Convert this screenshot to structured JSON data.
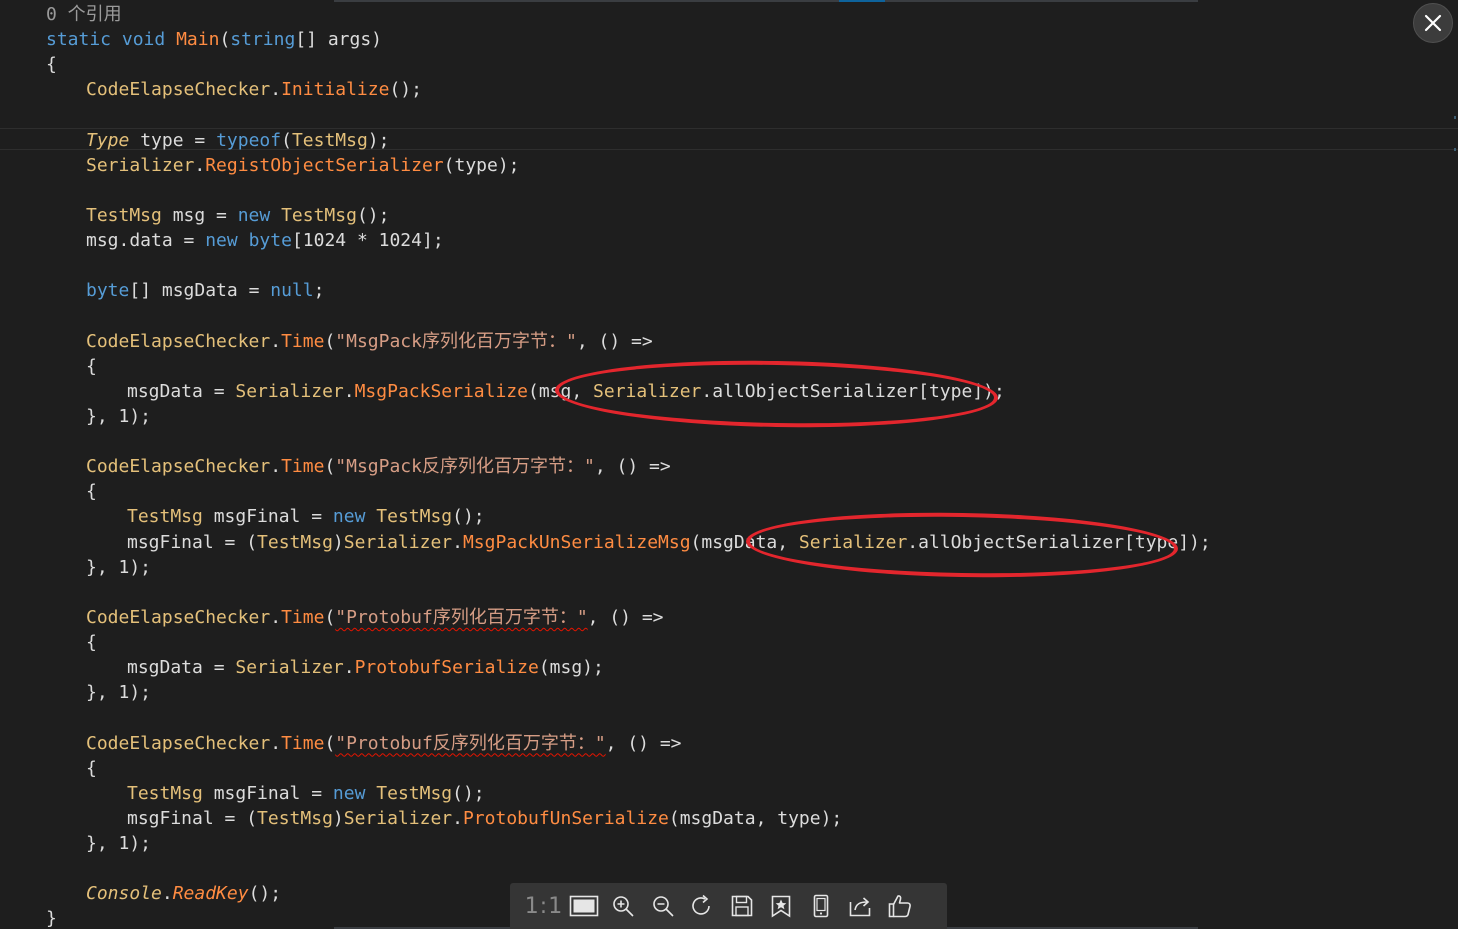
{
  "editor": {
    "lines": [
      {
        "indent": 1,
        "tokens": [
          {
            "t": "0 个引用",
            "c": "ref"
          }
        ]
      },
      {
        "indent": 1,
        "tokens": [
          {
            "t": "static",
            "c": "kw"
          },
          {
            "t": " ",
            "c": "pln"
          },
          {
            "t": "void",
            "c": "kw"
          },
          {
            "t": " ",
            "c": "pln"
          },
          {
            "t": "Main",
            "c": "mth"
          },
          {
            "t": "(",
            "c": "pln"
          },
          {
            "t": "string",
            "c": "kw"
          },
          {
            "t": "[] args)",
            "c": "pln"
          }
        ]
      },
      {
        "indent": 1,
        "tokens": [
          {
            "t": "{",
            "c": "pln"
          }
        ]
      },
      {
        "indent": 2,
        "tokens": [
          {
            "t": "CodeElapseChecker",
            "c": "cls"
          },
          {
            "t": ".",
            "c": "pln"
          },
          {
            "t": "Initialize",
            "c": "mth"
          },
          {
            "t": "();",
            "c": "pln"
          }
        ]
      },
      {
        "indent": 0,
        "tokens": []
      },
      {
        "indent": 2,
        "tokens": [
          {
            "t": "Type",
            "c": "cls ital"
          },
          {
            "t": " type = ",
            "c": "pln"
          },
          {
            "t": "typeof",
            "c": "kw"
          },
          {
            "t": "(",
            "c": "pln"
          },
          {
            "t": "TestMsg",
            "c": "cls"
          },
          {
            "t": ");",
            "c": "pln"
          }
        ]
      },
      {
        "indent": 2,
        "tokens": [
          {
            "t": "Serializer",
            "c": "cls"
          },
          {
            "t": ".",
            "c": "pln"
          },
          {
            "t": "RegistObjectSerializer",
            "c": "mth"
          },
          {
            "t": "(type);",
            "c": "pln"
          }
        ]
      },
      {
        "indent": 0,
        "tokens": []
      },
      {
        "indent": 2,
        "tokens": [
          {
            "t": "TestMsg",
            "c": "cls"
          },
          {
            "t": " msg = ",
            "c": "pln"
          },
          {
            "t": "new",
            "c": "kw"
          },
          {
            "t": " ",
            "c": "pln"
          },
          {
            "t": "TestMsg",
            "c": "cls"
          },
          {
            "t": "();",
            "c": "pln"
          }
        ]
      },
      {
        "indent": 2,
        "tokens": [
          {
            "t": "msg.data = ",
            "c": "pln"
          },
          {
            "t": "new",
            "c": "kw"
          },
          {
            "t": " ",
            "c": "pln"
          },
          {
            "t": "byte",
            "c": "kw"
          },
          {
            "t": "[1024 * 1024];",
            "c": "pln"
          }
        ]
      },
      {
        "indent": 0,
        "tokens": []
      },
      {
        "indent": 2,
        "tokens": [
          {
            "t": "byte",
            "c": "kw"
          },
          {
            "t": "[] msgData = ",
            "c": "pln"
          },
          {
            "t": "null",
            "c": "kw"
          },
          {
            "t": ";",
            "c": "pln"
          }
        ]
      },
      {
        "indent": 0,
        "tokens": []
      },
      {
        "indent": 2,
        "tokens": [
          {
            "t": "CodeElapseChecker",
            "c": "cls"
          },
          {
            "t": ".",
            "c": "pln"
          },
          {
            "t": "Time",
            "c": "mth"
          },
          {
            "t": "(",
            "c": "pln"
          },
          {
            "t": "\"MsgPack序列化百万字节：\"",
            "c": "str"
          },
          {
            "t": ", () =>",
            "c": "pln"
          }
        ]
      },
      {
        "indent": 2,
        "tokens": [
          {
            "t": "{",
            "c": "pln"
          }
        ]
      },
      {
        "indent": 3,
        "tokens": [
          {
            "t": "msgData = ",
            "c": "pln"
          },
          {
            "t": "Serializer",
            "c": "cls"
          },
          {
            "t": ".",
            "c": "pln"
          },
          {
            "t": "MsgPackSerialize",
            "c": "mth"
          },
          {
            "t": "(msg, ",
            "c": "pln"
          },
          {
            "t": "Serializer",
            "c": "cls"
          },
          {
            "t": ".allObjectSerializer[type]);",
            "c": "pln"
          }
        ]
      },
      {
        "indent": 2,
        "tokens": [
          {
            "t": "}, 1);",
            "c": "pln"
          }
        ]
      },
      {
        "indent": 0,
        "tokens": []
      },
      {
        "indent": 2,
        "tokens": [
          {
            "t": "CodeElapseChecker",
            "c": "cls"
          },
          {
            "t": ".",
            "c": "pln"
          },
          {
            "t": "Time",
            "c": "mth"
          },
          {
            "t": "(",
            "c": "pln"
          },
          {
            "t": "\"MsgPack反序列化百万字节：\"",
            "c": "str"
          },
          {
            "t": ", () =>",
            "c": "pln"
          }
        ]
      },
      {
        "indent": 2,
        "tokens": [
          {
            "t": "{",
            "c": "pln"
          }
        ]
      },
      {
        "indent": 3,
        "tokens": [
          {
            "t": "TestMsg",
            "c": "cls"
          },
          {
            "t": " msgFinal = ",
            "c": "pln"
          },
          {
            "t": "new",
            "c": "kw"
          },
          {
            "t": " ",
            "c": "pln"
          },
          {
            "t": "TestMsg",
            "c": "cls"
          },
          {
            "t": "();",
            "c": "pln"
          }
        ]
      },
      {
        "indent": 3,
        "tokens": [
          {
            "t": "msgFinal = (",
            "c": "pln"
          },
          {
            "t": "TestMsg",
            "c": "cls"
          },
          {
            "t": ")",
            "c": "pln"
          },
          {
            "t": "Serializer",
            "c": "cls"
          },
          {
            "t": ".",
            "c": "pln"
          },
          {
            "t": "MsgPackUnSerializeMsg",
            "c": "mth"
          },
          {
            "t": "(msgData, ",
            "c": "pln"
          },
          {
            "t": "Serializer",
            "c": "cls"
          },
          {
            "t": ".allObjectSerializer[type]);",
            "c": "pln"
          }
        ]
      },
      {
        "indent": 2,
        "tokens": [
          {
            "t": "}, 1);",
            "c": "pln"
          }
        ]
      },
      {
        "indent": 0,
        "tokens": []
      },
      {
        "indent": 2,
        "tokens": [
          {
            "t": "CodeElapseChecker",
            "c": "cls"
          },
          {
            "t": ".",
            "c": "pln"
          },
          {
            "t": "Time",
            "c": "mth"
          },
          {
            "t": "(",
            "c": "pln"
          },
          {
            "t": "\"Protobuf序列化百万字节：\"",
            "c": "str squig"
          },
          {
            "t": ", () =>",
            "c": "pln"
          }
        ]
      },
      {
        "indent": 2,
        "tokens": [
          {
            "t": "{",
            "c": "pln"
          }
        ]
      },
      {
        "indent": 3,
        "tokens": [
          {
            "t": "msgData = ",
            "c": "pln"
          },
          {
            "t": "Serializer",
            "c": "cls"
          },
          {
            "t": ".",
            "c": "pln"
          },
          {
            "t": "ProtobufSerialize",
            "c": "mth"
          },
          {
            "t": "(msg);",
            "c": "pln"
          }
        ]
      },
      {
        "indent": 2,
        "tokens": [
          {
            "t": "}, 1);",
            "c": "pln"
          }
        ]
      },
      {
        "indent": 0,
        "tokens": []
      },
      {
        "indent": 2,
        "tokens": [
          {
            "t": "CodeElapseChecker",
            "c": "cls"
          },
          {
            "t": ".",
            "c": "pln"
          },
          {
            "t": "Time",
            "c": "mth"
          },
          {
            "t": "(",
            "c": "pln"
          },
          {
            "t": "\"Protobuf反序列化百万字节：\"",
            "c": "str squig"
          },
          {
            "t": ", () =>",
            "c": "pln"
          }
        ]
      },
      {
        "indent": 2,
        "tokens": [
          {
            "t": "{",
            "c": "pln"
          }
        ]
      },
      {
        "indent": 3,
        "tokens": [
          {
            "t": "TestMsg",
            "c": "cls"
          },
          {
            "t": " msgFinal = ",
            "c": "pln"
          },
          {
            "t": "new",
            "c": "kw"
          },
          {
            "t": " ",
            "c": "pln"
          },
          {
            "t": "TestMsg",
            "c": "cls"
          },
          {
            "t": "();",
            "c": "pln"
          }
        ]
      },
      {
        "indent": 3,
        "tokens": [
          {
            "t": "msgFinal = (",
            "c": "pln"
          },
          {
            "t": "TestMsg",
            "c": "cls"
          },
          {
            "t": ")",
            "c": "pln"
          },
          {
            "t": "Serializer",
            "c": "cls"
          },
          {
            "t": ".",
            "c": "pln"
          },
          {
            "t": "ProtobufUnSerialize",
            "c": "mth"
          },
          {
            "t": "(msgData, type);",
            "c": "pln"
          }
        ]
      },
      {
        "indent": 2,
        "tokens": [
          {
            "t": "}, 1);",
            "c": "pln"
          }
        ]
      },
      {
        "indent": 0,
        "tokens": []
      },
      {
        "indent": 2,
        "tokens": [
          {
            "t": "Console",
            "c": "cls ital"
          },
          {
            "t": ".",
            "c": "pln"
          },
          {
            "t": "ReadKey",
            "c": "mth ital"
          },
          {
            "t": "();",
            "c": "pln"
          }
        ]
      },
      {
        "indent": 1,
        "tokens": [
          {
            "t": "}",
            "c": "pln"
          }
        ]
      }
    ]
  },
  "annotations": {
    "color": "#e3262d",
    "highlighted_text": "Serializer.allObjectSerializer[type]"
  },
  "viewer": {
    "close_icon": "close-icon",
    "zoom_ratio": "1:1",
    "toolbar_icons": [
      "fit-window-icon",
      "zoom-in-icon",
      "zoom-out-icon",
      "rotate-icon",
      "save-icon",
      "favorite-icon",
      "phone-icon",
      "share-icon",
      "thumbs-up-icon"
    ]
  },
  "colors": {
    "background": "#1e1e1e",
    "keyword": "#569cd6",
    "class": "#e4c07a",
    "method": "#ff8c42",
    "string": "#d69d85",
    "plain": "#dcdcdc",
    "reference": "#9a9a9a",
    "toolbar": "#353535"
  }
}
